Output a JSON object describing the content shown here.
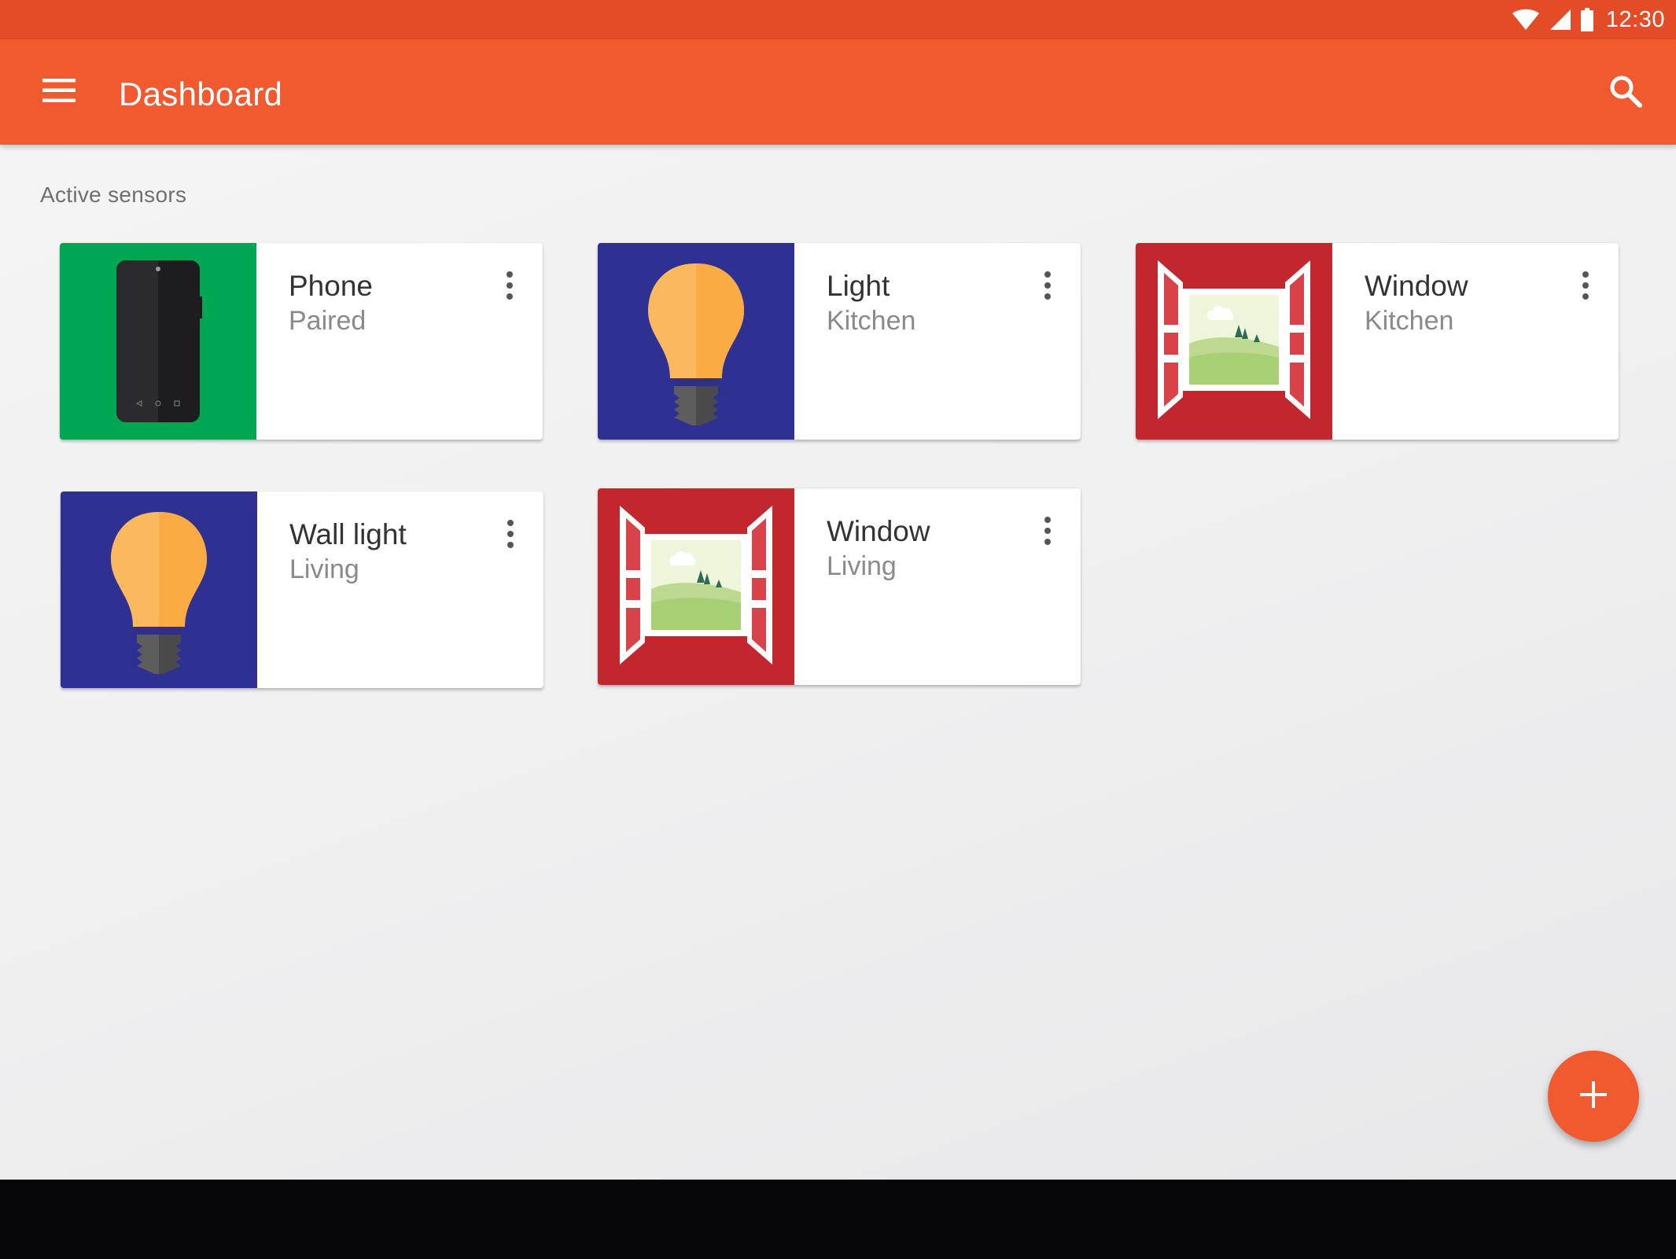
{
  "status_bar": {
    "time": "12:30",
    "icons": [
      "wifi-icon",
      "cellular-signal-icon",
      "battery-icon"
    ]
  },
  "app_bar": {
    "menu_icon": "hamburger-menu-icon",
    "title": "Dashboard",
    "search_icon": "search-icon"
  },
  "section": {
    "title": "Active sensors"
  },
  "cards": [
    {
      "title": "Phone",
      "subtitle": "Paired",
      "icon": "phone-icon",
      "thumb_color": "#00a651"
    },
    {
      "title": "Light",
      "subtitle": "Kitchen",
      "icon": "light-bulb-icon",
      "thumb_color": "#2e3192"
    },
    {
      "title": "Window",
      "subtitle": "Kitchen",
      "icon": "window-icon",
      "thumb_color": "#c1272d"
    },
    {
      "title": "Wall light",
      "subtitle": "Living",
      "icon": "light-bulb-icon",
      "thumb_color": "#2e3192"
    },
    {
      "title": "Window",
      "subtitle": "Living",
      "icon": "window-icon",
      "thumb_color": "#c1272d"
    }
  ],
  "fab": {
    "icon": "plus-icon"
  },
  "colors": {
    "status_bar": "#e44c27",
    "app_bar": "#f15a2e",
    "accent": "#f15a2e",
    "nav_bar": "#070709"
  }
}
